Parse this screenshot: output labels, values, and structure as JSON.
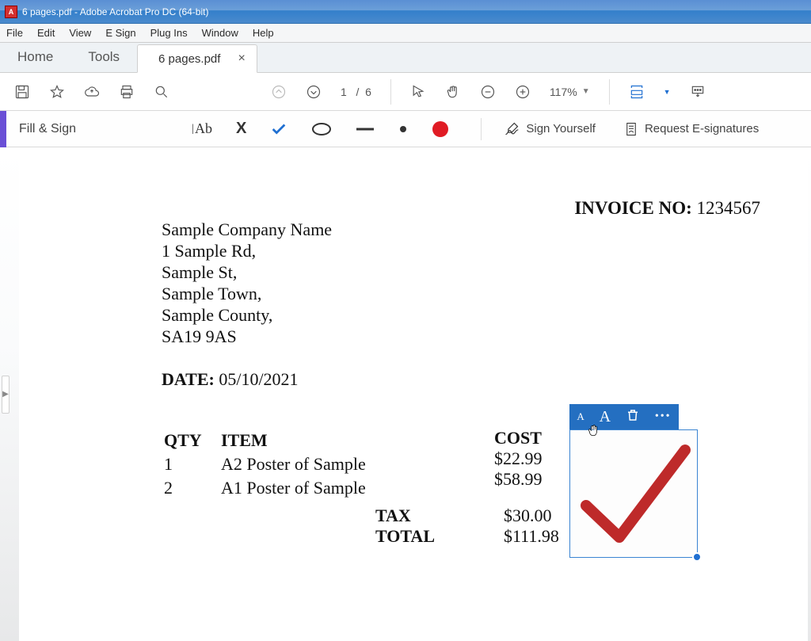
{
  "window": {
    "title": "6 pages.pdf - Adobe Acrobat Pro DC (64-bit)"
  },
  "menubar": [
    "File",
    "Edit",
    "View",
    "E Sign",
    "Plug Ins",
    "Window",
    "Help"
  ],
  "tabs": {
    "home": "Home",
    "tools": "Tools",
    "doc": "6 pages.pdf",
    "close": "×"
  },
  "toolbar": {
    "page_cur": "1",
    "page_div": "/",
    "page_total": "6",
    "zoom": "117%"
  },
  "signbar": {
    "title": "Fill & Sign",
    "sign_yourself": "Sign Yourself",
    "request": "Request E-signatures"
  },
  "annot_toolbar": {
    "small": "A",
    "big": "A",
    "more": "•••"
  },
  "doc": {
    "invoice_label": "INVOICE NO:",
    "invoice_no": " 1234567",
    "company": [
      "Sample Company Name",
      "1 Sample Rd,",
      "Sample St,",
      "Sample Town,",
      "Sample County,",
      "SA19 9AS"
    ],
    "date_label": "DATE:",
    "date_value": " 05/10/2021",
    "headers": {
      "qty": "QTY",
      "item": "ITEM",
      "cost": "COST"
    },
    "lines": [
      {
        "qty": "1",
        "item": "A2 Poster of Sample",
        "cost": "$22.99"
      },
      {
        "qty": "2",
        "item": "A1 Poster of Sample",
        "cost": "$58.99"
      }
    ],
    "tax_label": "TAX",
    "tax_value": "$30.00",
    "total_label": "TOTAL",
    "total_value": "$111.98"
  }
}
